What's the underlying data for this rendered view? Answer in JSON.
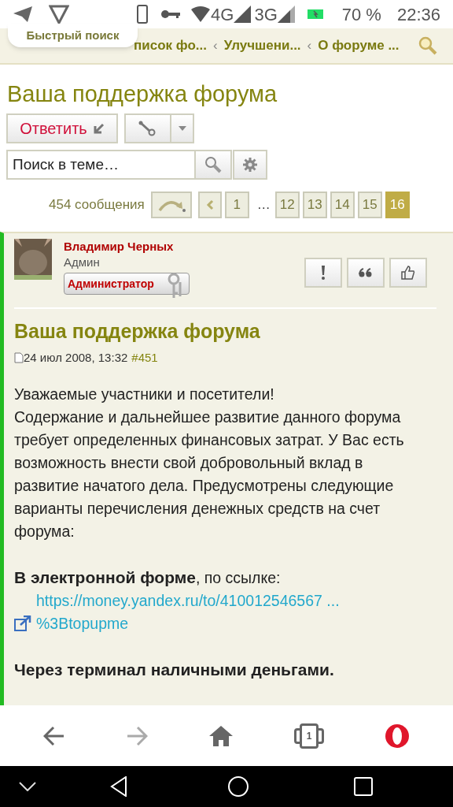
{
  "status_bar": {
    "battery": "70 %",
    "time": "22:36",
    "network_1": "4G",
    "network_2": "3G"
  },
  "tooltip": "Быстрый поиск",
  "breadcrumbs": [
    {
      "label": "писок фо..."
    },
    {
      "label": "Улучшени..."
    },
    {
      "label": "О форуме ..."
    }
  ],
  "separator": "‹",
  "page_title": "Ваша поддержка форума",
  "reply_button": "Ответить",
  "search": {
    "placeholder": "Поиск в теме…"
  },
  "pagination": {
    "count": "454 сообщения",
    "ellipsis": "…",
    "pages": [
      {
        "label": "1",
        "selected": false
      },
      {
        "label": "12",
        "selected": false
      },
      {
        "label": "13",
        "selected": false
      },
      {
        "label": "14",
        "selected": false
      },
      {
        "label": "15",
        "selected": false
      },
      {
        "label": "16",
        "selected": true
      }
    ]
  },
  "post": {
    "author": "Владимир Черных",
    "role": "Админ",
    "rank_badge": "Администратор",
    "title": "Ваша поддержка форума",
    "date": "24 июл 2008, 13:32",
    "number": "#451",
    "paragraphs": [
      "Уважаемые участники и посетители!\nСодержание и дальнейшее развитие данного форума требует определенных финансовых затрат. У Вас есть возможность внести свой добровольный вклад в развитие начатого дела. Предусмотрены следующие варианты перечисления денежных средств на счет форума:",
      "**В электронной форме**, по ссылке:"
    ],
    "link": [
      "https://money.yandex.ru/to/410012546567 ...",
      "%3Btopupme"
    ],
    "heading": "Через терминал наличными деньгами."
  },
  "browser_bar": {
    "tab_count": "1",
    "forward_disabled": true
  }
}
